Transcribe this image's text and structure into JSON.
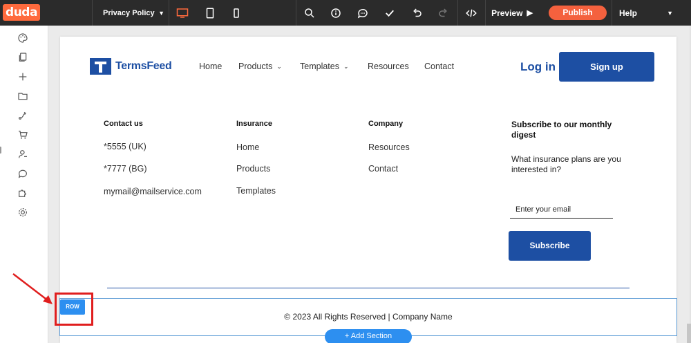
{
  "app": {
    "logo": "duda"
  },
  "toolbar": {
    "page_select": "Privacy Policy",
    "preview_label": "Preview",
    "publish_label": "Publish",
    "help_label": "Help",
    "active_device_color": "#ff6a3d"
  },
  "site": {
    "brand": "TermsFeed",
    "nav": [
      {
        "label": "Home"
      },
      {
        "label": "Products"
      },
      {
        "label": "Templates"
      },
      {
        "label": "Resources"
      },
      {
        "label": "Contact"
      }
    ],
    "login": "Log in",
    "signup": "Sign up",
    "footer": {
      "contact": {
        "heading": "Contact us",
        "items": [
          "*5555 (UK)",
          "*7777 (BG)",
          "mymail@mailservice.com"
        ]
      },
      "insurance": {
        "heading": "Insurance",
        "items": [
          "Home",
          "Products",
          "Templates"
        ]
      },
      "company": {
        "heading": "Company",
        "items": [
          "Resources",
          "Contact"
        ]
      },
      "subscribe": {
        "heading": "Subscribe to our monthly digest",
        "question": "What insurance plans are you interested in?",
        "email_placeholder": "Enter your email",
        "button": "Subscribe"
      },
      "copyright": "© 2023 All Rights Reserved | Company Name"
    }
  },
  "editor": {
    "row_tag": "ROW",
    "add_section": "+ Add Section"
  },
  "colors": {
    "brand_blue": "#1d4fa3",
    "publish": "#f4613e",
    "editor_blue": "#2d8ff0",
    "annotation_red": "#e01e1e"
  }
}
